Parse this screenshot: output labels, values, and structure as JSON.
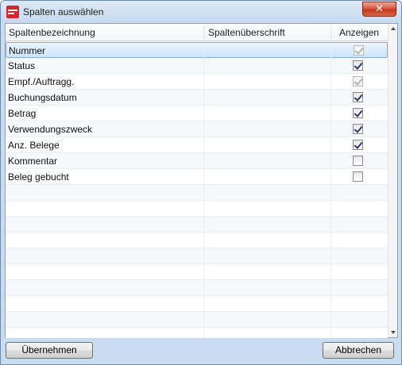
{
  "window": {
    "title": "Spalten auswählen",
    "close_icon": "close-x"
  },
  "columns": {
    "name": "Spaltenbezeichnung",
    "caption": "Spaltenüberschrift",
    "show": "Anzeigen"
  },
  "rows": [
    {
      "label": "Nummer",
      "caption": "",
      "checked": true,
      "disabled": true,
      "selected": true
    },
    {
      "label": "Status",
      "caption": "",
      "checked": true,
      "disabled": false,
      "selected": false
    },
    {
      "label": "Empf./Auftragg.",
      "caption": "",
      "checked": true,
      "disabled": true,
      "selected": false
    },
    {
      "label": "Buchungsdatum",
      "caption": "",
      "checked": true,
      "disabled": false,
      "selected": false
    },
    {
      "label": "Betrag",
      "caption": "",
      "checked": true,
      "disabled": false,
      "selected": false
    },
    {
      "label": "Verwendungszweck",
      "caption": "",
      "checked": true,
      "disabled": false,
      "selected": false
    },
    {
      "label": "Anz. Belege",
      "caption": "",
      "checked": true,
      "disabled": false,
      "selected": false
    },
    {
      "label": "Kommentar",
      "caption": "",
      "checked": false,
      "disabled": false,
      "selected": false
    },
    {
      "label": "Beleg gebucht",
      "caption": "",
      "checked": false,
      "disabled": false,
      "selected": false
    }
  ],
  "footer": {
    "apply_label": "Übernehmen",
    "cancel_label": "Abbrechen"
  }
}
